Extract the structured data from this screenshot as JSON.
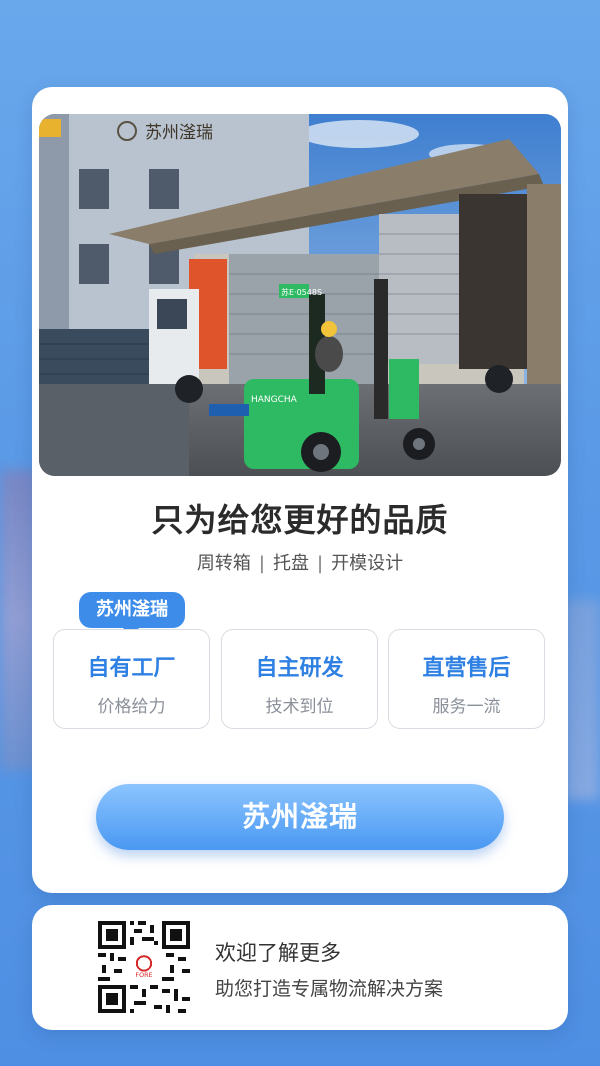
{
  "photo": {
    "building_sign": "苏州滏瑞",
    "forklift_brand": "HANGCHA",
    "plate": "苏E·0548S"
  },
  "headline": "只为给您更好的品质",
  "services": [
    "周转箱",
    "托盘",
    "开模设计"
  ],
  "separator": "|",
  "badge": "苏州滏瑞",
  "features": [
    {
      "title": "自有工厂",
      "subtitle": "价格给力"
    },
    {
      "title": "自主研发",
      "subtitle": "技术到位"
    },
    {
      "title": "直营售后",
      "subtitle": "服务一流"
    }
  ],
  "cta_label": "苏州滏瑞",
  "contact": {
    "title": "欢迎了解更多",
    "subtitle": "助您打造专属物流解决方案",
    "qr_logo_text": "FORE"
  },
  "colors": {
    "accent": "#3d8cea",
    "feature_title": "#2f80e3",
    "background": "#5b9ae6"
  }
}
